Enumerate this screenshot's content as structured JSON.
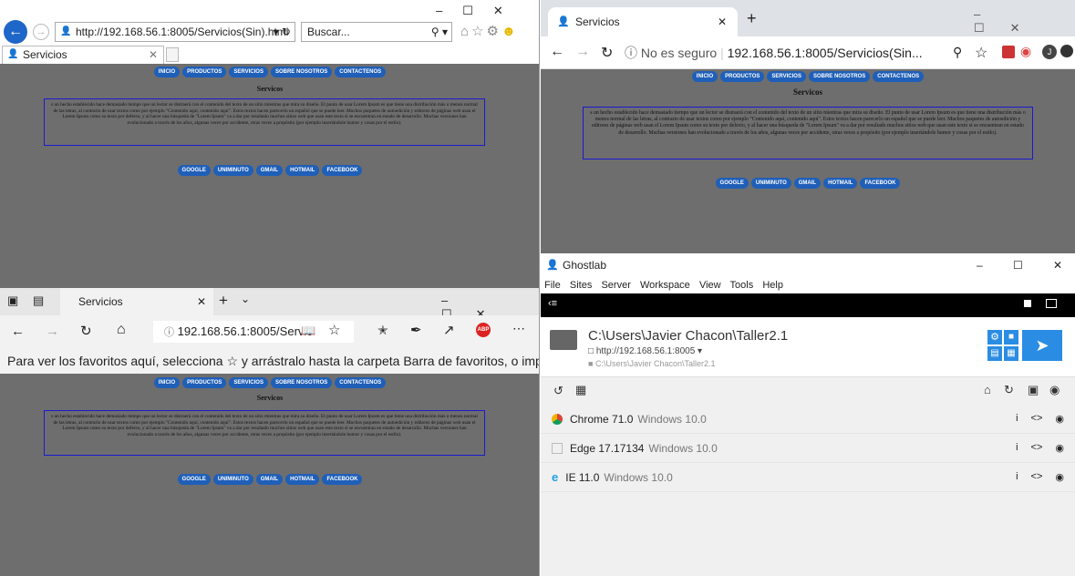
{
  "site": {
    "nav": [
      "INICIO",
      "PRODUCTOS",
      "SERVICIOS",
      "SOBRE NOSOTROS",
      "CONTACTENOS"
    ],
    "heading": "Servicos",
    "paragraph": "s un hecho establecido hace demasiado tiempo que un lector se distraerá con el contenido del texto de un sitio mientras que mira su diseño. El punto de usar Lorem Ipsum es que tiene una distribución más o menos normal de las letras, al contrario de usar textos como por ejemplo \"Contenido aquí, contenido aquí\". Estos textos hacen parecerlo un español que se puede leer. Muchos paquetes de autoedición y editores de páginas web usan el Lorem Ipsum como su texto por defecto, y al hacer una búsqueda de \"Lorem Ipsum\" va a dar por resultado muchos sitios web que usan este texto si se encuentran en estado de desarrollo. Muchas versiones han evolucionado a través de los años, algunas veces por accidente, otras veces a propósito (por ejemplo insertándole humor y cosas por el estilo).",
    "links": [
      "GOOGLE",
      "UNIMINUTO",
      "GMAIL",
      "HOTMAIL",
      "FACEBOOK"
    ]
  },
  "ie": {
    "url": "http://192.168.56.1:8005/Servicios(Sin).html",
    "search_placeholder": "Buscar...",
    "tab": "Servicios"
  },
  "chrome": {
    "tab": "Servicios",
    "security": "No es seguro",
    "url": "192.168.56.1:8005/Servicios(Sin...",
    "avatar": "J"
  },
  "edge": {
    "tab": "Servicios",
    "url": "192.168.56.1:8005/Servic",
    "favbar": "Para ver los favoritos aquí, selecciona ☆ y arrástralo hasta la carpeta Barra de favoritos, o impórtalo"
  },
  "ghostlab": {
    "title": "Ghostlab",
    "menu": [
      "File",
      "Sites",
      "Server",
      "Workspace",
      "View",
      "Tools",
      "Help"
    ],
    "site_path": "C:\\Users\\Javier Chacon\\Taller2.1",
    "site_url": "http://192.168.56.1:8005",
    "site_dir": "C:\\Users\\Javier Chacon\\Taller2.1",
    "clients": [
      {
        "name": "Chrome 71.0",
        "os": "Windows 10.0",
        "icon": "chrome-icon"
      },
      {
        "name": "Edge 17.17134",
        "os": "Windows 10.0",
        "icon": "edge-icon"
      },
      {
        "name": "IE 11.0",
        "os": "Windows 10.0",
        "icon": "ie-icon"
      }
    ],
    "colors": {
      "accent": "#2b8ce3",
      "toolbar": "#000000"
    }
  }
}
